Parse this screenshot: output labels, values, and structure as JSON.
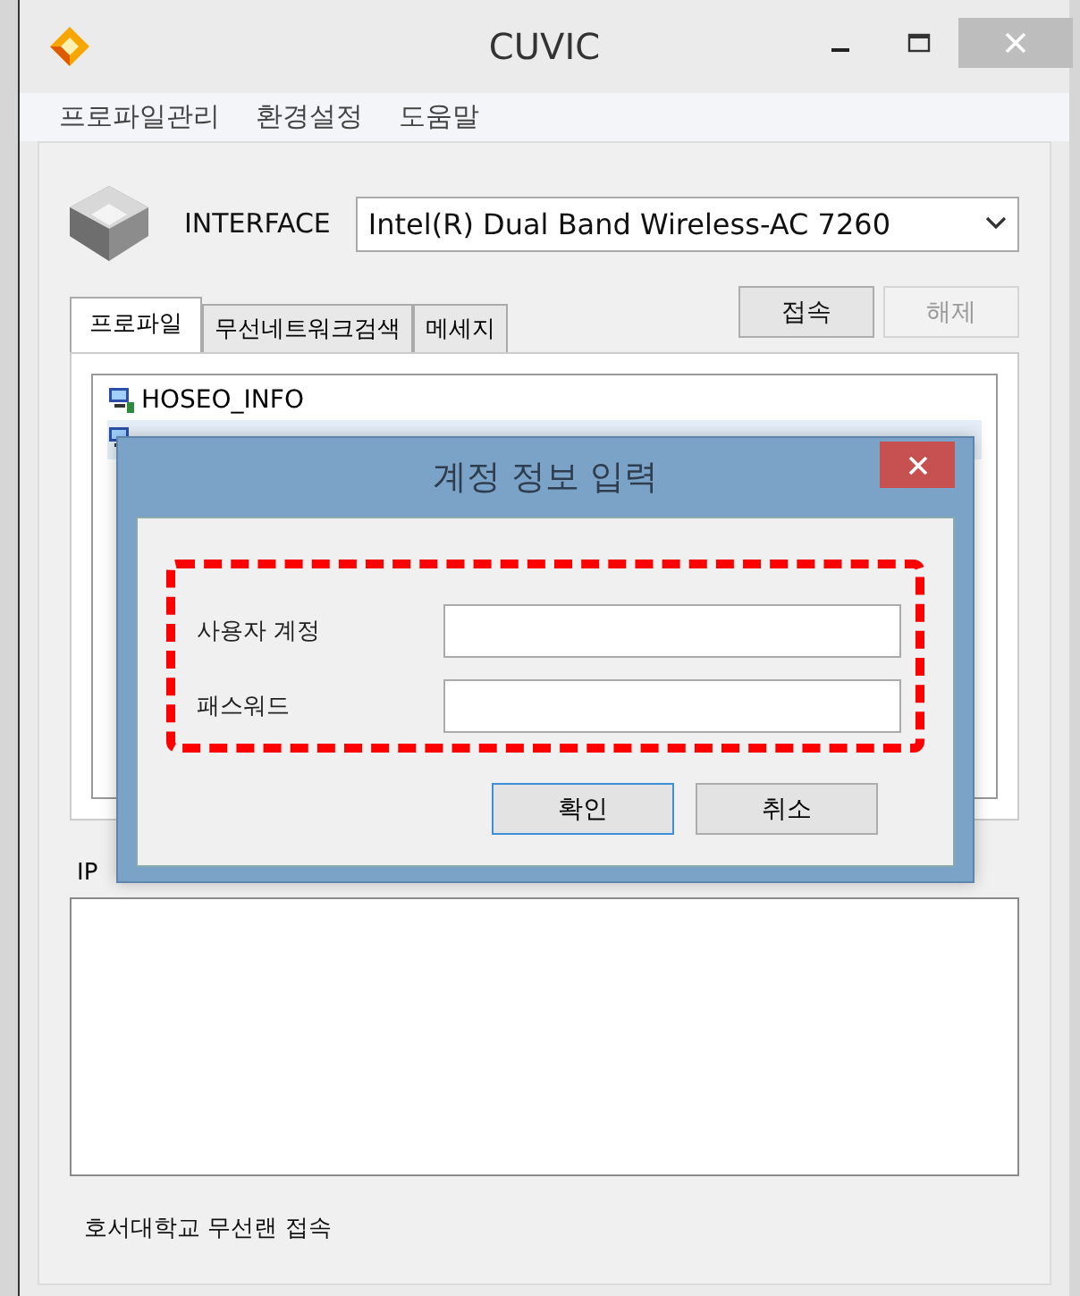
{
  "window": {
    "title": "CUVIC"
  },
  "menu": [
    "프로파일관리",
    "환경설정",
    "도움말"
  ],
  "interface": {
    "label": "INTERFACE",
    "value": "Intel(R) Dual Band Wireless-AC 7260"
  },
  "buttons": [
    {
      "label": "접속",
      "disabled": false
    },
    {
      "label": "해제",
      "disabled": true
    }
  ],
  "tabs": [
    {
      "label": "프로파일",
      "selected": true
    },
    {
      "label": "무선네트워크검색",
      "selected": false
    },
    {
      "label": "메세지",
      "selected": false
    }
  ],
  "profiles": [
    {
      "label": "HOSEO_INFO",
      "selected": false
    },
    {
      "selected": true
    }
  ],
  "ip_label": "IP",
  "status": "호서대학교 무선랜 접속",
  "dialog": {
    "title": "계정 정보 입력",
    "fields": [
      {
        "label": "사용자 계정"
      },
      {
        "label": "패스워드"
      }
    ],
    "buttons": [
      {
        "label": "확인",
        "default": true
      },
      {
        "label": "취소",
        "default": false
      }
    ]
  }
}
